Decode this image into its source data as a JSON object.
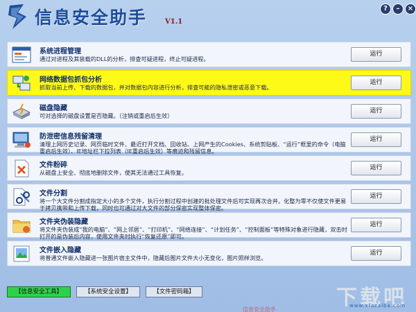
{
  "app": {
    "title": "信息安全助手",
    "version": "V1.1",
    "buttons": {
      "help": "?",
      "minimize": "–",
      "close": "×"
    }
  },
  "tools": [
    {
      "title": "系统进程管理",
      "desc": "通过对进程及其装载的DLL的分析，排查可疑进程，终止可疑进程。",
      "button": "运行",
      "icon": "window-icon",
      "highlight": false
    },
    {
      "title": "网络数据包抓包分析",
      "desc": "抓取当前上传、下载的数据包，并对数据包内容进行分析，排查可能的隐私泄密或恶意下载。",
      "button": "运行",
      "icon": "network-icon",
      "highlight": true
    },
    {
      "title": "磁盘隐藏",
      "desc": "可对选择的磁盘设置是否隐藏。（注销或重启后生效）",
      "button": "运行",
      "icon": "disk-icon",
      "highlight": false
    },
    {
      "title": "防泄密信息残留清理",
      "desc": "清理上网历史记录、网页临时文件、最近打开文档、回收站、上网产生的Cookies、系统剪贴板、“运行”框里的命令（电脑重启后生效）、IE地址栏下拉列表（IE重启后生效）等痕迹和残留信息。",
      "button": "运行",
      "icon": "computer-icon",
      "highlight": false
    },
    {
      "title": "文件粉碎",
      "desc": "从磁盘上安全、彻底地删除文件，使其无法通过工具恢复。",
      "button": "运行",
      "icon": "file-shred-icon",
      "highlight": false
    },
    {
      "title": "文件分割",
      "desc": "将一个大文件分割成指定大小的多个文件，执行分割过程中创建的批处理文件后可实现再次合并。化整为零不仅使文件更易于拷贝携带和上传下载，同时也可通过对大文件的部分保密实现整体保密。",
      "button": "运行",
      "icon": "file-split-icon",
      "highlight": false
    },
    {
      "title": "文件夹伪装隐藏",
      "desc": "将文件夹伪装成“我的电脑”、“网上邻居”、“打印机”、“网络连接”、“计划任务”、“控制面板”等特殊对象进行隐藏，双击时打开的是伪装后内容，使用文件夹时执行“恢复还原”即可。",
      "button": "运行",
      "icon": "folder-icon",
      "highlight": false
    },
    {
      "title": "文件嵌入隐藏",
      "desc": "将普通文件嵌入隐藏进一张图片宿主文件中，隐藏后图片文件大小无变化，图片照样浏览。",
      "button": "运行",
      "icon": "image-icon",
      "highlight": false
    }
  ],
  "tabs": [
    {
      "label": "【信息安全工具】",
      "active": true
    },
    {
      "label": "【系统安全设置】",
      "active": false
    },
    {
      "label": "【文件密码箱】",
      "active": false
    }
  ],
  "watermark": {
    "text": "下载吧",
    "url": "www.xiazaiba.com"
  },
  "footer": "信息安全助手"
}
